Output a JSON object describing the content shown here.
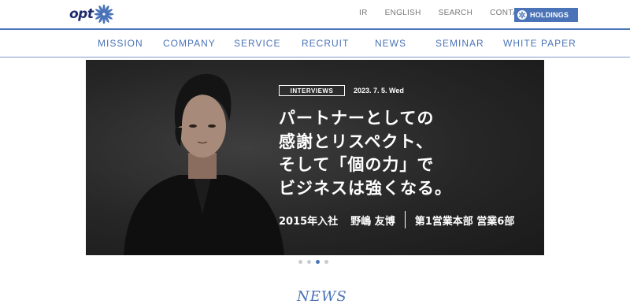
{
  "header": {
    "logo_text": "opt",
    "util_links": [
      "IR",
      "ENGLISH",
      "SEARCH",
      "CONTACT"
    ],
    "holdings_label": "HOLDINGS"
  },
  "nav": {
    "items": [
      "MISSION",
      "COMPANY",
      "SERVICE",
      "RECRUIT",
      "NEWS",
      "SEMINAR",
      "WHITE PAPER"
    ]
  },
  "hero": {
    "tag": "INTERVIEWS",
    "date": "2023. 7. 5. Wed",
    "headline": [
      "パートナーとしての",
      "感謝とリスペクト、",
      "そして「個の力」で",
      "ビジネスは強くなる。"
    ],
    "join_year": "2015年入社",
    "person_name": "野嶋 友博",
    "department": "第1営業本部 営業6部"
  },
  "carousel": {
    "slide_count": 4,
    "active_index": 2
  },
  "news": {
    "heading": "NEWS"
  },
  "colors": {
    "accent": "#4a73b8",
    "logo": "#1e2a6e",
    "hero_bg": "#262626"
  }
}
